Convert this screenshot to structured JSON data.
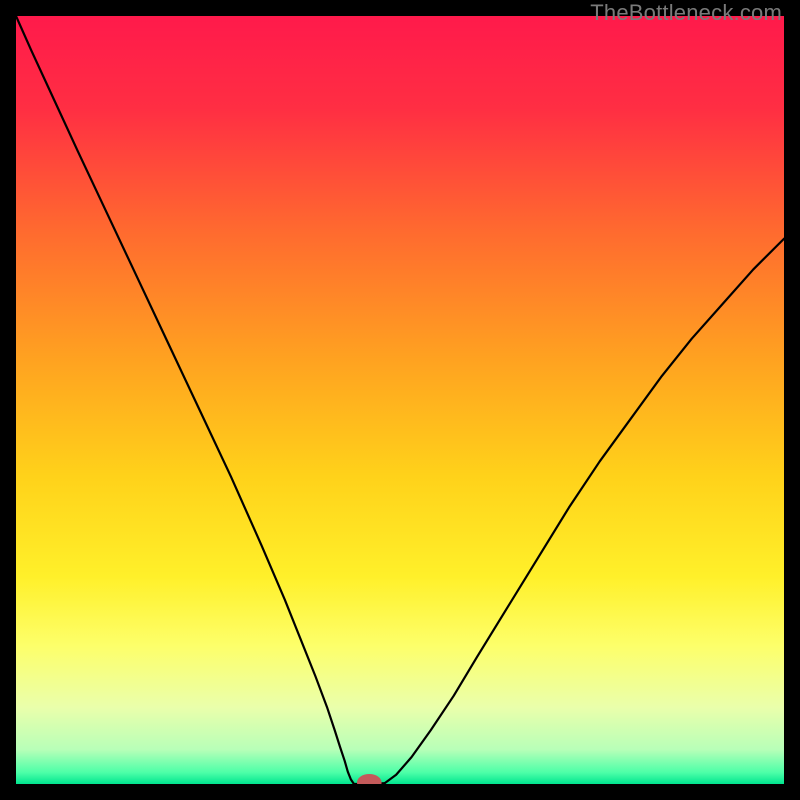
{
  "watermark": "TheBottleneck.com",
  "chart_data": {
    "type": "line",
    "title": "",
    "xlabel": "",
    "ylabel": "",
    "xlim": [
      0,
      100
    ],
    "ylim": [
      0,
      100
    ],
    "background_gradient_stops": [
      {
        "pos": 0.0,
        "color": "#ff1a4b"
      },
      {
        "pos": 0.12,
        "color": "#ff2e43"
      },
      {
        "pos": 0.28,
        "color": "#ff6a2f"
      },
      {
        "pos": 0.45,
        "color": "#ffa320"
      },
      {
        "pos": 0.6,
        "color": "#ffd21a"
      },
      {
        "pos": 0.73,
        "color": "#fff02a"
      },
      {
        "pos": 0.82,
        "color": "#fdff6a"
      },
      {
        "pos": 0.9,
        "color": "#eaffab"
      },
      {
        "pos": 0.955,
        "color": "#b8ffb8"
      },
      {
        "pos": 0.985,
        "color": "#4dffa8"
      },
      {
        "pos": 1.0,
        "color": "#00e58f"
      }
    ],
    "series": [
      {
        "name": "left-branch",
        "stroke": "#000000",
        "width": 2.2,
        "x": [
          0,
          2,
          5,
          8,
          12,
          16,
          20,
          24,
          28,
          32,
          35,
          37,
          39,
          40.5,
          41.5,
          42.2,
          42.8,
          43.2,
          43.6,
          44.0
        ],
        "y": [
          100,
          95.5,
          89,
          82.5,
          74,
          65.5,
          57,
          48.5,
          40,
          31,
          24,
          19,
          14,
          10,
          7,
          4.8,
          3.0,
          1.6,
          0.6,
          0.0
        ]
      },
      {
        "name": "floor",
        "stroke": "#000000",
        "width": 2.2,
        "x": [
          44.0,
          46.0,
          48.0
        ],
        "y": [
          0.0,
          0.0,
          0.1
        ]
      },
      {
        "name": "right-branch",
        "stroke": "#000000",
        "width": 2.2,
        "x": [
          48.0,
          49.5,
          51.5,
          54,
          57,
          60,
          64,
          68,
          72,
          76,
          80,
          84,
          88,
          92,
          96,
          100
        ],
        "y": [
          0.1,
          1.2,
          3.5,
          7.0,
          11.5,
          16.5,
          23.0,
          29.5,
          36.0,
          42.0,
          47.5,
          53.0,
          58.0,
          62.5,
          67.0,
          71.0
        ]
      }
    ],
    "marker": {
      "name": "min-marker",
      "x": 46.0,
      "y": 0.2,
      "rx": 1.6,
      "ry": 1.1,
      "fill": "#c45a5a"
    }
  }
}
